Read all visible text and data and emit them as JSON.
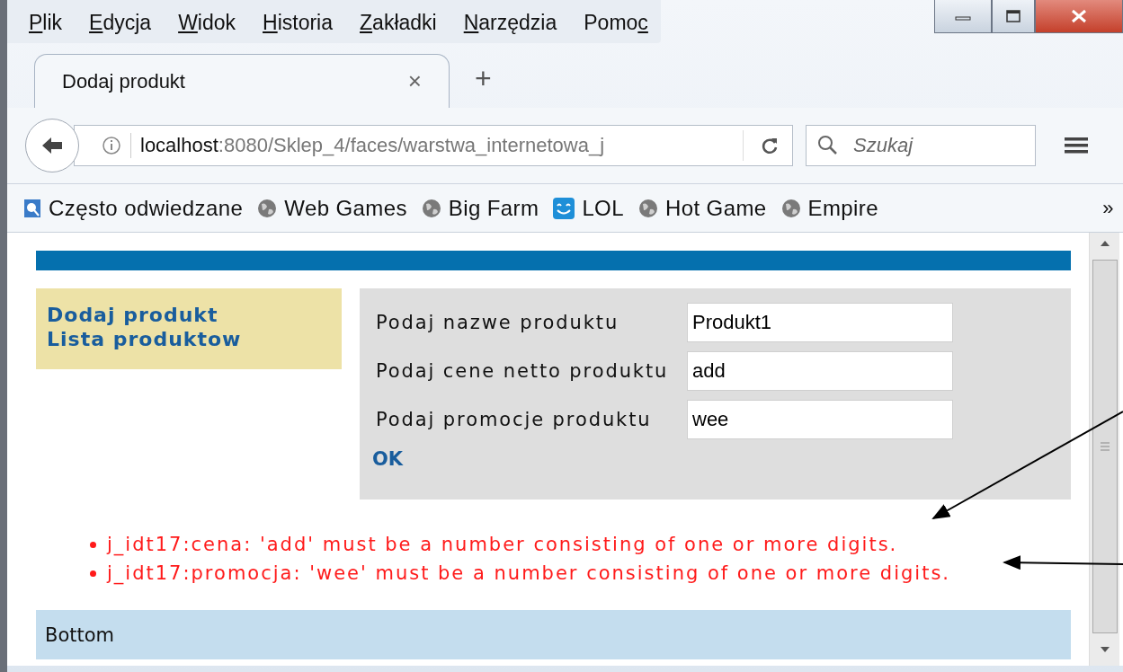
{
  "menu_bar": [
    {
      "key": "P",
      "after": "lik"
    },
    {
      "key": "E",
      "after": "dycja"
    },
    {
      "key": "W",
      "after": "idok"
    },
    {
      "key": "H",
      "after": "istoria"
    },
    {
      "key": "Z",
      "after": "akładki"
    },
    {
      "key": "N",
      "after": "arzędzia"
    },
    {
      "before": "Pomo",
      "key": "c"
    }
  ],
  "tabs": [
    {
      "label": "Dodaj produkt",
      "selected": true,
      "close": "×"
    }
  ],
  "new_tab": "+",
  "address_bar": {
    "host": "localhost",
    "rest": ":8080/Sklep_4/faces/warstwa_internetowa_j"
  },
  "search": {
    "placeholder": "Szukaj"
  },
  "bookmarks": [
    {
      "label": "Często odwiedzane",
      "kind": "folder"
    },
    {
      "label": "Web Games",
      "kind": "globe"
    },
    {
      "label": "Big Farm",
      "kind": "globe"
    },
    {
      "label": "LOL",
      "kind": "smile"
    },
    {
      "label": "Hot Game",
      "kind": "globe"
    },
    {
      "label": "Empire",
      "kind": "globe"
    }
  ],
  "bookmarks_overflow": "»",
  "page": {
    "sidebar": [
      "Dodaj produkt",
      "Lista produktow"
    ],
    "form": {
      "fields": [
        {
          "label": "Podaj nazwe produktu",
          "value": "Produkt1"
        },
        {
          "label": "Podaj cene netto produktu",
          "value": "add"
        },
        {
          "label": "Podaj promocje produktu",
          "value": "wee"
        }
      ],
      "submit": "OK"
    },
    "errors": [
      "j_idt17:cena: 'add' must be a number consisting of one or more digits.",
      "j_idt17:promocja: 'wee' must be a number consisting of one or more digits."
    ],
    "footer": "Bottom"
  }
}
